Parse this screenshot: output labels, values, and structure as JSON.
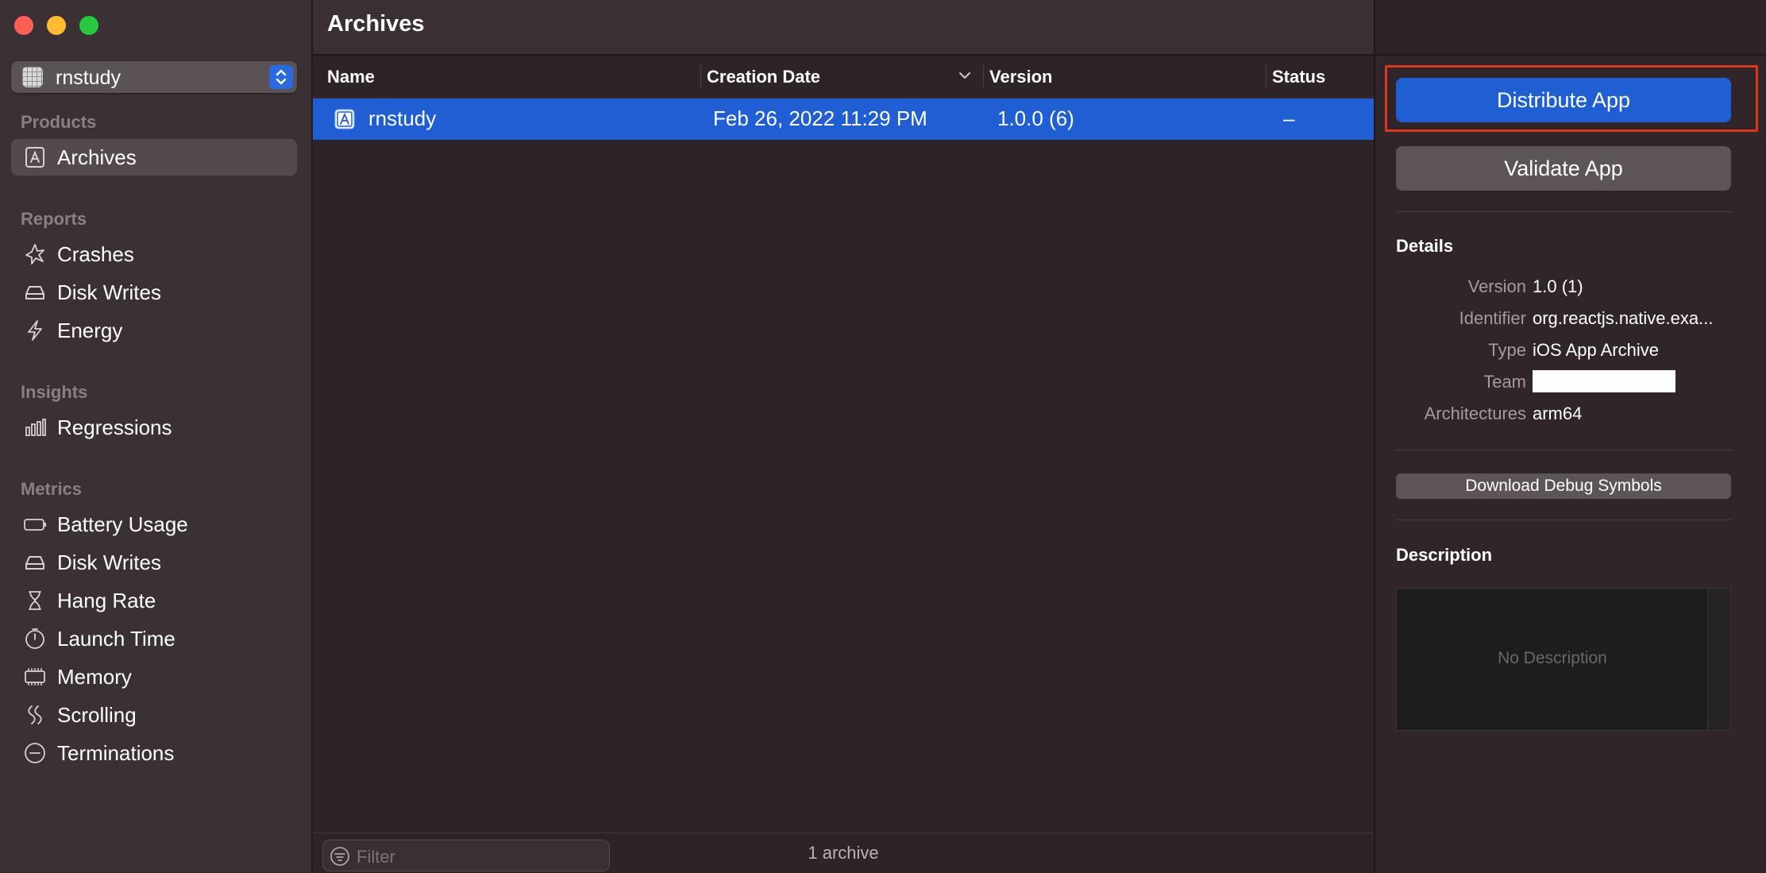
{
  "sidebar": {
    "scheme": {
      "label": "rnstudy"
    },
    "sections": {
      "products": "Products",
      "reports": "Reports",
      "insights": "Insights",
      "metrics": "Metrics"
    },
    "items": {
      "archives": "Archives",
      "crashes": "Crashes",
      "disk_writes": "Disk Writes",
      "energy": "Energy",
      "regressions": "Regressions",
      "battery_usage": "Battery Usage",
      "disk_writes_metrics": "Disk Writes",
      "hang_rate": "Hang Rate",
      "launch_time": "Launch Time",
      "memory": "Memory",
      "scrolling": "Scrolling",
      "terminations": "Terminations"
    }
  },
  "main": {
    "title": "Archives",
    "columns": {
      "name": "Name",
      "creation_date": "Creation Date",
      "version": "Version",
      "status": "Status"
    },
    "rows": [
      {
        "name": "rnstudy",
        "creation_date": "Feb 26, 2022 11:29 PM",
        "version": "1.0.0 (6)",
        "status": "–"
      }
    ],
    "filter_placeholder": "Filter",
    "archive_count": "1 archive"
  },
  "panel": {
    "distribute_label": "Distribute App",
    "validate_label": "Validate App",
    "details_heading": "Details",
    "details": {
      "version_key": "Version",
      "version_val": "1.0 (1)",
      "identifier_key": "Identifier",
      "identifier_val": "org.reactjs.native.exa...",
      "type_key": "Type",
      "type_val": "iOS App Archive",
      "team_key": "Team",
      "arch_key": "Architectures",
      "arch_val": "arm64"
    },
    "download_label": "Download Debug Symbols",
    "description_heading": "Description",
    "description_placeholder": "No Description"
  },
  "colors": {
    "accent": "#1f5fd3",
    "highlight_border": "#e0341d"
  }
}
